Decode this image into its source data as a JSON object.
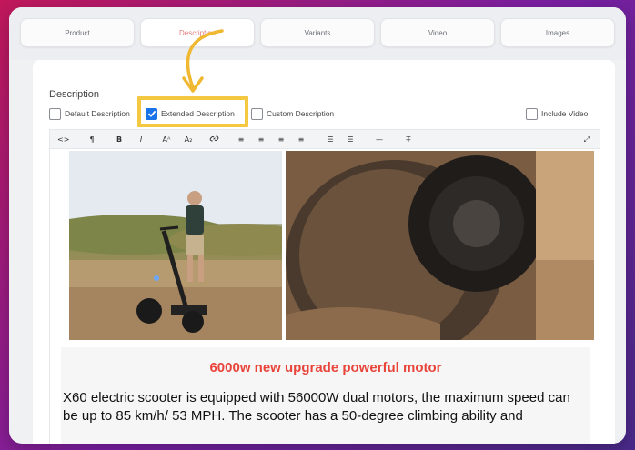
{
  "tabs": [
    {
      "label": "Product"
    },
    {
      "label": "Description"
    },
    {
      "label": "Variants"
    },
    {
      "label": "Video"
    },
    {
      "label": "Images"
    }
  ],
  "section": {
    "title": "Description"
  },
  "options": {
    "default_description": {
      "label": "Default Description",
      "checked": false
    },
    "extended_description": {
      "label": "Extended Description",
      "checked": true
    },
    "custom_description": {
      "label": "Custom Description",
      "checked": false
    },
    "include_video": {
      "label": "Include Video",
      "checked": false
    }
  },
  "toolbar": {
    "code_view": "<>",
    "paragraph": "¶",
    "bold": "B",
    "italic": "I",
    "font_size": "Aᴬ",
    "subscript": "A₂",
    "link": "🔗",
    "align_left": "≡",
    "align_center": "≡",
    "align_right": "≡",
    "align_justify": "≡",
    "bullet_list": "☰",
    "numbered_list": "☰",
    "horizontal_rule": "—",
    "clear_format": "T̶",
    "fullscreen": "⤢"
  },
  "content": {
    "headline": "6000w new upgrade powerful motor",
    "paragraph": "X60 electric scooter is equipped with 56000W dual motors, the maximum speed can be up to 85 km/h/ 53 MPH. The scooter has a 50-degree climbing ability and"
  },
  "colors": {
    "accent_highlight": "#f5c842",
    "checkbox_checked": "#1a73e8",
    "headline": "#e8443a",
    "active_tab_text": "#e07b7b"
  }
}
